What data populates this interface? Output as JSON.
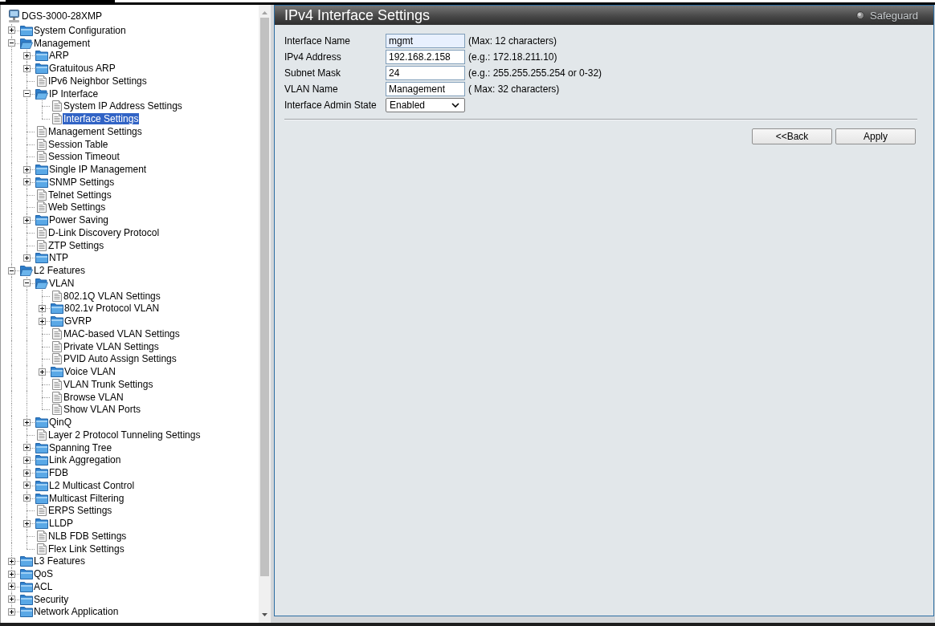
{
  "tree": {
    "root": {
      "label": "DGS-3000-28XMP"
    },
    "items": [
      {
        "label": "System Configuration",
        "kind": "folder",
        "expanded": false,
        "selected": false
      },
      {
        "label": "Management",
        "kind": "folder",
        "expanded": true,
        "selected": false,
        "children": [
          {
            "label": "ARP",
            "kind": "folder",
            "expanded": false,
            "selected": false
          },
          {
            "label": "Gratuitous ARP",
            "kind": "folder",
            "expanded": false,
            "selected": false
          },
          {
            "label": "IPv6 Neighbor Settings",
            "kind": "page",
            "selected": false
          },
          {
            "label": "IP Interface",
            "kind": "folder",
            "expanded": true,
            "selected": false,
            "children": [
              {
                "label": "System IP Address Settings",
                "kind": "page",
                "selected": false
              },
              {
                "label": "Interface Settings",
                "kind": "page",
                "selected": true
              }
            ]
          },
          {
            "label": "Management Settings",
            "kind": "page",
            "selected": false
          },
          {
            "label": "Session Table",
            "kind": "page",
            "selected": false
          },
          {
            "label": "Session Timeout",
            "kind": "page",
            "selected": false
          },
          {
            "label": "Single IP Management",
            "kind": "folder",
            "expanded": false,
            "selected": false
          },
          {
            "label": "SNMP Settings",
            "kind": "folder",
            "expanded": false,
            "selected": false
          },
          {
            "label": "Telnet Settings",
            "kind": "page",
            "selected": false
          },
          {
            "label": "Web Settings",
            "kind": "page",
            "selected": false
          },
          {
            "label": "Power Saving",
            "kind": "folder",
            "expanded": false,
            "selected": false
          },
          {
            "label": "D-Link Discovery Protocol",
            "kind": "page",
            "selected": false
          },
          {
            "label": "ZTP Settings",
            "kind": "page",
            "selected": false
          },
          {
            "label": "NTP",
            "kind": "folder",
            "expanded": false,
            "selected": false
          }
        ]
      },
      {
        "label": "L2 Features",
        "kind": "folder",
        "expanded": true,
        "selected": false,
        "children": [
          {
            "label": "VLAN",
            "kind": "folder",
            "expanded": true,
            "selected": false,
            "children": [
              {
                "label": "802.1Q VLAN Settings",
                "kind": "page",
                "selected": false
              },
              {
                "label": "802.1v Protocol VLAN",
                "kind": "folder",
                "expanded": false,
                "selected": false
              },
              {
                "label": "GVRP",
                "kind": "folder",
                "expanded": false,
                "selected": false
              },
              {
                "label": "MAC-based VLAN Settings",
                "kind": "page",
                "selected": false
              },
              {
                "label": "Private VLAN Settings",
                "kind": "page",
                "selected": false
              },
              {
                "label": "PVID Auto Assign Settings",
                "kind": "page",
                "selected": false
              },
              {
                "label": "Voice VLAN",
                "kind": "folder",
                "expanded": false,
                "selected": false
              },
              {
                "label": "VLAN Trunk Settings",
                "kind": "page",
                "selected": false
              },
              {
                "label": "Browse VLAN",
                "kind": "page",
                "selected": false
              },
              {
                "label": "Show VLAN Ports",
                "kind": "page",
                "selected": false
              }
            ]
          },
          {
            "label": "QinQ",
            "kind": "folder",
            "expanded": false,
            "selected": false
          },
          {
            "label": "Layer 2 Protocol Tunneling Settings",
            "kind": "page",
            "selected": false
          },
          {
            "label": "Spanning Tree",
            "kind": "folder",
            "expanded": false,
            "selected": false
          },
          {
            "label": "Link Aggregation",
            "kind": "folder",
            "expanded": false,
            "selected": false
          },
          {
            "label": "FDB",
            "kind": "folder",
            "expanded": false,
            "selected": false
          },
          {
            "label": "L2 Multicast Control",
            "kind": "folder",
            "expanded": false,
            "selected": false
          },
          {
            "label": "Multicast Filtering",
            "kind": "folder",
            "expanded": false,
            "selected": false
          },
          {
            "label": "ERPS Settings",
            "kind": "page",
            "selected": false
          },
          {
            "label": "LLDP",
            "kind": "folder",
            "expanded": false,
            "selected": false
          },
          {
            "label": "NLB FDB Settings",
            "kind": "page",
            "selected": false
          },
          {
            "label": "Flex Link Settings",
            "kind": "page",
            "selected": false
          }
        ]
      },
      {
        "label": "L3 Features",
        "kind": "folder",
        "expanded": false,
        "selected": false
      },
      {
        "label": "QoS",
        "kind": "folder",
        "expanded": false,
        "selected": false
      },
      {
        "label": "ACL",
        "kind": "folder",
        "expanded": false,
        "selected": false
      },
      {
        "label": "Security",
        "kind": "folder",
        "expanded": false,
        "selected": false
      },
      {
        "label": "Network Application",
        "kind": "folder",
        "expanded": false,
        "selected": false
      }
    ]
  },
  "panel": {
    "title": "IPv4 Interface Settings",
    "safeguard": "Safeguard",
    "fields": [
      {
        "kind": "text",
        "label": "Interface Name",
        "value": "mgmt",
        "hint": "(Max: 12 characters)",
        "autofilled": true
      },
      {
        "kind": "text",
        "label": "IPv4 Address",
        "value": "192.168.2.158",
        "hint": "(e.g.: 172.18.211.10)",
        "autofilled": false
      },
      {
        "kind": "text",
        "label": "Subnet Mask",
        "value": "24",
        "hint": "(e.g.: 255.255.255.254 or 0-32)",
        "autofilled": false
      },
      {
        "kind": "text",
        "label": "VLAN Name",
        "value": "Management",
        "hint": "( Max: 32 characters)",
        "autofilled": false
      },
      {
        "kind": "select",
        "label": "Interface Admin State",
        "value": "Enabled"
      }
    ],
    "buttons": [
      "<<Back",
      "Apply"
    ]
  }
}
